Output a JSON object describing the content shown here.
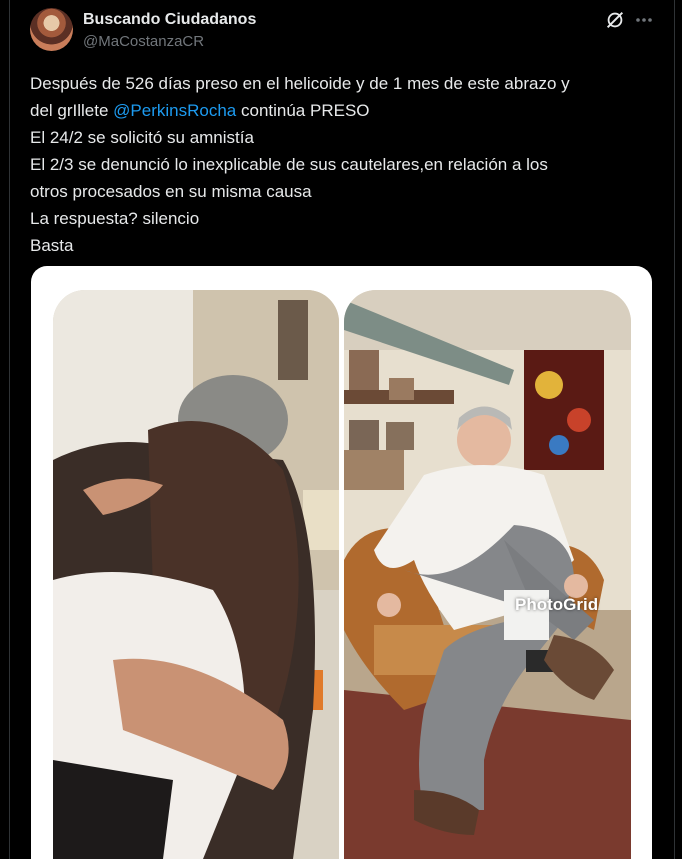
{
  "author": {
    "display_name": "Buscando Ciudadanos",
    "handle": "@MaCostanzaCR"
  },
  "icons": {
    "grok": "grok-icon",
    "more": "more-icon"
  },
  "tweet": {
    "line1": "Después de 526 días preso en el helicoide y de 1 mes de este abrazo y",
    "line2_pre": "del grIllete ",
    "mention": "@PerkinsRocha",
    "line2_post": " continúa PRESO",
    "line3": "El 24/2 se solicitó su amnistía",
    "line4": "El 2/3 se denunció lo inexplicable de sus cautelares,en relación a los",
    "line5": "otros procesados en su misma causa",
    "line6": "La respuesta? silencio",
    "line7": "Basta"
  },
  "media": {
    "watermark": "PhotoGrid"
  },
  "colors": {
    "background": "#000000",
    "text": "#e7e9ea",
    "muted": "#71767b",
    "link": "#1d9bf0"
  }
}
